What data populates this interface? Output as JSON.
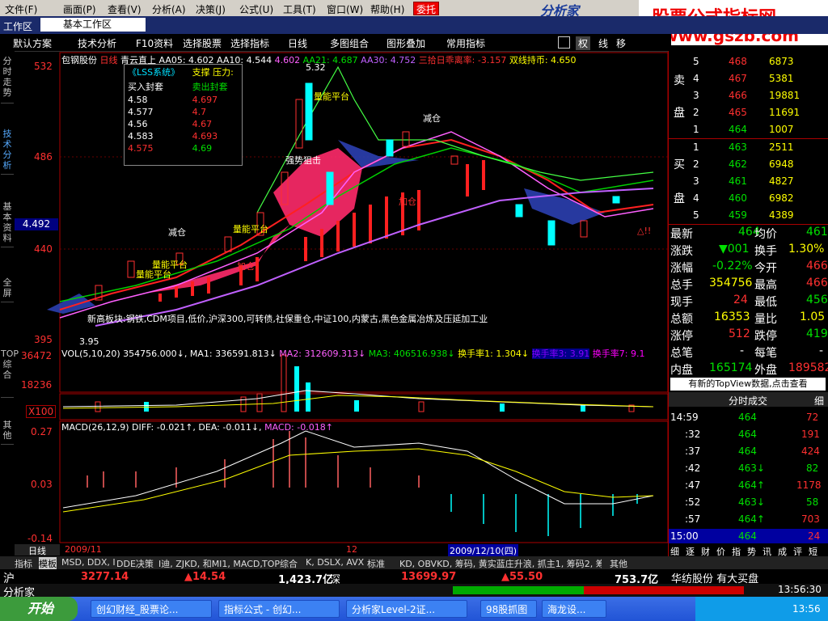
{
  "menubar": {
    "items": [
      "文件(F)",
      "画面(P)",
      "查看(V)",
      "分析(A)",
      "决策(J)",
      "公式(U)",
      "工具(T)",
      "窗口(W)",
      "帮助(H)"
    ],
    "trust_btn": "委托",
    "app_logo": "分析家",
    "watermark_title": "股票公式指标网",
    "watermark_url": "www.gszb.com"
  },
  "workspace": {
    "label": "工作区",
    "tab": "基本工作区"
  },
  "toolbar": {
    "items": [
      "默认方案",
      "技术分析",
      "F10资料",
      "选择股票",
      "选择指标",
      "日线",
      "多图组合",
      "图形叠加",
      "常用指标"
    ],
    "right_buttons": [
      "权",
      "线",
      "移"
    ]
  },
  "left_tabs": [
    "分时走势",
    "技术分析",
    "基本资料",
    "全屏",
    "TOP综合",
    "其他"
  ],
  "chart": {
    "header": {
      "stock": "包钢股份",
      "period": "日线",
      "indicator": "青云直上",
      "aa05": "AA05: 4.602",
      "aa10": "AA10: 4.544",
      "aa10b": "4.602",
      "aa21": "AA21: 4.687",
      "aa30": "AA30: 4.752",
      "sanshi": "三拾日乖离率: -3.157",
      "shuangxian": "双线持币: 4.650"
    },
    "y_ticks": [
      "532",
      "486",
      "440",
      "395"
    ],
    "current_price_label": "4.492",
    "annotations": {
      "high": "5.32",
      "low": "3.95",
      "jian1": "减仓",
      "jian2": "减仓",
      "jia1": "加仓",
      "jia2": "加仓",
      "liang1": "量能平台",
      "liang2": "量能平台",
      "liang3": "量能平台",
      "liang4": "量能平台",
      "qiangshi": "强势狙击",
      "delta": "△!!"
    },
    "sector": "新高板块:钢铁,CDM项目,低价,沪深300,可转债,社保重仓,中证100,内蒙古,黑色金属冶炼及压延加工业",
    "lss": {
      "title": "《LSS系统》",
      "support": "支撑",
      "pressure": "压力:",
      "buy_header": "买入封套",
      "sell_header": "卖出封套",
      "rows": [
        [
          "4.58",
          "4.697"
        ],
        [
          "4.577",
          "4.7"
        ],
        [
          "4.56",
          "4.67"
        ],
        [
          "4.583",
          "4.693"
        ],
        [
          "4.575",
          "4.69"
        ]
      ]
    },
    "x_labels": {
      "a": "2009/11",
      "b": "12",
      "c": "2009/12/10(四)"
    },
    "period_tab": "日线"
  },
  "volume": {
    "header": "VOL(5,10,20) 354756.000↓, MA1: 336591.813↓",
    "ma2": "MA2: 312609.313↓",
    "ma3": "MA3: 406516.938↓",
    "turnover": "换手率1: 1.304↓",
    "turnover3": "换手率3: 3.91",
    "turnover7": "换手率7: 9.1",
    "y_ticks": [
      "36472",
      "18236"
    ],
    "unit": "X100"
  },
  "macd": {
    "header": "MACD(26,12,9) DIFF: -0.021↑, DEA: -0.011↓,",
    "macd_val": "MACD: -0.018↑",
    "y_ticks": [
      "0.27",
      "0.03",
      "-0.14"
    ]
  },
  "orderbook": {
    "sell_label": [
      "卖",
      "盘"
    ],
    "buy_label": [
      "买",
      "盘"
    ],
    "sell": [
      [
        "5",
        "468",
        "6873"
      ],
      [
        "4",
        "467",
        "5381"
      ],
      [
        "3",
        "466",
        "19881"
      ],
      [
        "2",
        "465",
        "11691"
      ],
      [
        "1",
        "464",
        "1007"
      ]
    ],
    "buy": [
      [
        "1",
        "463",
        "2511"
      ],
      [
        "2",
        "462",
        "6948"
      ],
      [
        "3",
        "461",
        "4827"
      ],
      [
        "4",
        "460",
        "6982"
      ],
      [
        "5",
        "459",
        "4389"
      ]
    ]
  },
  "quote": {
    "rows": [
      [
        "最新",
        "464",
        "均价",
        "461"
      ],
      [
        "涨跌",
        "▼001",
        "换手",
        "1.30%"
      ],
      [
        "涨幅",
        "-0.22%",
        "今开",
        "466"
      ],
      [
        "总手",
        "354756",
        "最高",
        "466"
      ],
      [
        "现手",
        "24",
        "最低",
        "456"
      ],
      [
        "总额",
        "16353",
        "量比",
        "1.05"
      ],
      [
        "涨停",
        "512",
        "跌停",
        "419"
      ],
      [
        "总笔",
        "-",
        "每笔",
        "-"
      ],
      [
        "内盘",
        "165174",
        "外盘",
        "189582"
      ]
    ],
    "topview": "有新的TopView数据,点击查看",
    "ticks_title": "分时成交",
    "ticks_btn": "细",
    "ticks": [
      [
        "14:59",
        "464",
        "72"
      ],
      [
        ":32",
        "464",
        "191"
      ],
      [
        ":37",
        "464",
        "424"
      ],
      [
        ":42",
        "463↓",
        "82"
      ],
      [
        ":47",
        "464↑",
        "1178"
      ],
      [
        ":52",
        "463↓",
        "58"
      ],
      [
        ":57",
        "464↑",
        "703"
      ],
      [
        "15:00",
        "464",
        "24"
      ]
    ],
    "tabs": [
      "细",
      "逐",
      "财",
      "价",
      "指",
      "势",
      "讯",
      "成",
      "评",
      "短"
    ]
  },
  "bottom_tabs": [
    "指标",
    "模板",
    "MSD, DDX, I",
    "DDE决策",
    "I迪, ZJKD, 和MI1, MACD,",
    "TOP综合",
    "K, DSLX, AVX",
    "标准",
    "KD, OBVKD, 筹码, 黄实蓝庄升浪, 抓主1, 筹码2, 筹",
    "其他"
  ],
  "status": {
    "sh_label": "沪",
    "sh_index": "3277.14",
    "sh_change": "▲14.54",
    "sh_amount": "1,423.7亿",
    "sz_label": "深",
    "sz_index": "13699.97",
    "sz_change": "▲55.50",
    "sz_amount": "753.7亿",
    "news": "华纺股份 有大买盘",
    "app": "分析家",
    "time": "13:56:30"
  },
  "taskbar": {
    "start": "开始",
    "items": [
      "创幻财经_股票论...",
      "指标公式 - 创幻...",
      "分析家Level-2证...",
      "98股抓图",
      "海龙设..."
    ],
    "clock": "13:56"
  }
}
